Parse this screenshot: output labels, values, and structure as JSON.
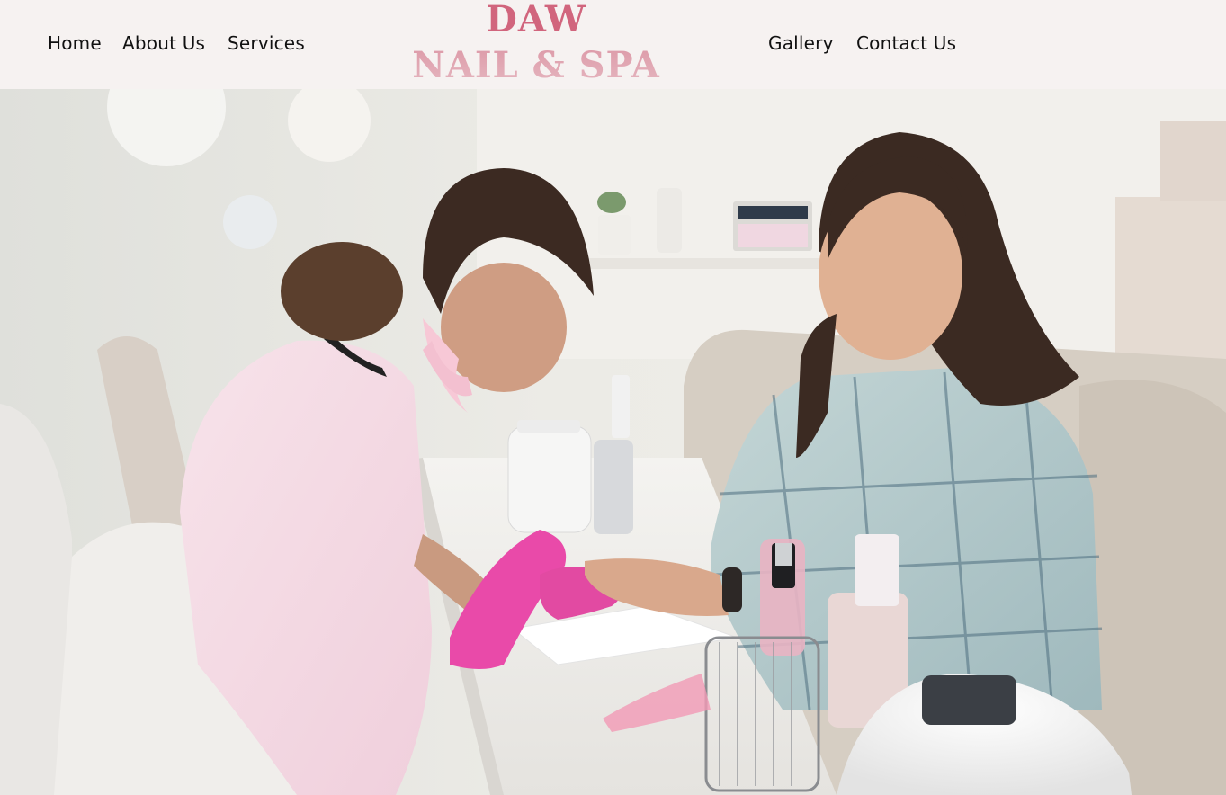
{
  "nav": {
    "left": [
      {
        "label": "Home"
      },
      {
        "label": "About Us"
      },
      {
        "label": "Services"
      }
    ],
    "right": [
      {
        "label": "Gallery"
      },
      {
        "label": "Contact Us"
      }
    ]
  },
  "logo": {
    "line1": "DAW",
    "line2": "NAIL & SPA"
  },
  "colors": {
    "header_bg": "#f6f2f1",
    "logo_primary": "#d1657d",
    "logo_secondary": "#dd9aa8",
    "glove_pink": "#e94aa9"
  },
  "hero": {
    "icon": "nail-salon-photo"
  }
}
